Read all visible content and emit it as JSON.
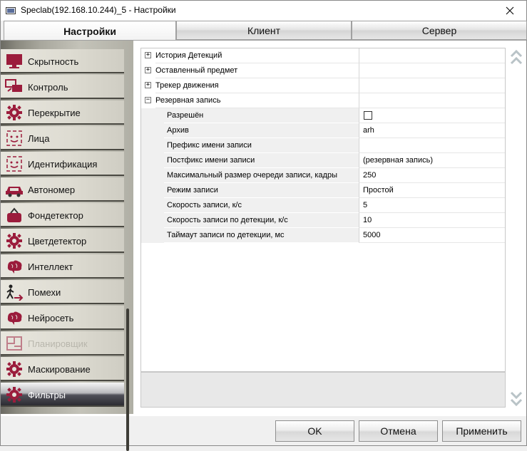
{
  "window": {
    "title": "Speclab(192.168.10.244)_5 - Настройки",
    "close_icon": "close-icon"
  },
  "tabs": [
    {
      "label": "Настройки",
      "active": true
    },
    {
      "label": "Клиент",
      "active": false
    },
    {
      "label": "Сервер",
      "active": false
    }
  ],
  "sidebar": {
    "items": [
      {
        "label": "Скрытность",
        "icon": "monitor-icon",
        "state": "normal"
      },
      {
        "label": "Контроль",
        "icon": "monitors-icon",
        "state": "normal"
      },
      {
        "label": "Перекрытие",
        "icon": "gear-icon",
        "state": "normal"
      },
      {
        "label": "Лица",
        "icon": "face-icon",
        "state": "normal"
      },
      {
        "label": "Идентификация",
        "icon": "face-id-icon",
        "state": "normal"
      },
      {
        "label": "Автономер",
        "icon": "car-icon",
        "state": "normal"
      },
      {
        "label": "Фондетектор",
        "icon": "bag-icon",
        "state": "normal"
      },
      {
        "label": "Цветдетектор",
        "icon": "gear-icon",
        "state": "normal"
      },
      {
        "label": "Интеллект",
        "icon": "brain-icon",
        "state": "normal"
      },
      {
        "label": "Помехи",
        "icon": "walker-icon",
        "state": "normal"
      },
      {
        "label": "Нейросеть",
        "icon": "brain-icon",
        "state": "normal"
      },
      {
        "label": "Планировщик",
        "icon": "plan-icon",
        "state": "disabled"
      },
      {
        "label": "Маскирование",
        "icon": "gear-icon",
        "state": "normal"
      },
      {
        "label": "Фильтры",
        "icon": "gear-icon",
        "state": "active"
      }
    ]
  },
  "grid": {
    "categories": [
      {
        "label": "История Детекций",
        "expanded": false
      },
      {
        "label": "Оставленный предмет",
        "expanded": false
      },
      {
        "label": "Трекер движения",
        "expanded": false
      },
      {
        "label": "Резервная запись",
        "expanded": true
      }
    ],
    "properties": [
      {
        "name": "Разрешён",
        "value": "",
        "type": "checkbox",
        "checked": false
      },
      {
        "name": "Архив",
        "value": "arh"
      },
      {
        "name": "Префикс имени записи",
        "value": ""
      },
      {
        "name": "Постфикс имени записи",
        "value": "(резервная запись)"
      },
      {
        "name": "Максимальный размер очереди записи, кадры",
        "value": "250"
      },
      {
        "name": "Режим записи",
        "value": "Простой"
      },
      {
        "name": "Скорость записи, к/с",
        "value": "5"
      },
      {
        "name": "Скорость записи по детекции, к/с",
        "value": "10"
      },
      {
        "name": "Таймаут записи по детекции, мс",
        "value": "5000"
      }
    ]
  },
  "buttons": {
    "ok": "OK",
    "cancel": "Отмена",
    "apply": "Применить"
  },
  "colors": {
    "icon_accent": "#9b1c3c",
    "active_item_dark": "#2c2c33"
  }
}
